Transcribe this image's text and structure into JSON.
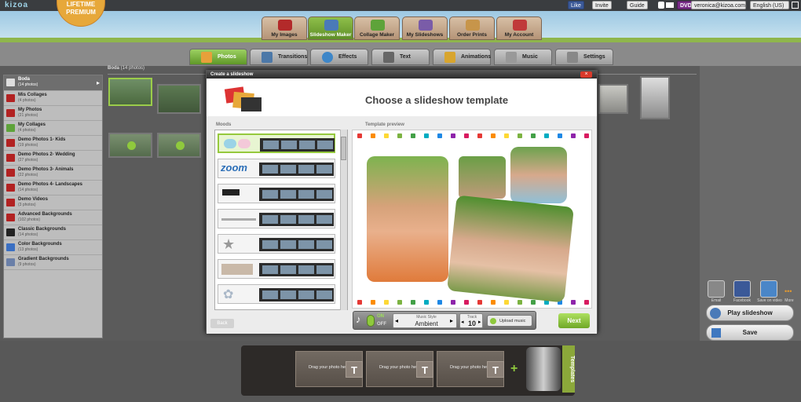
{
  "app": {
    "logo": "kizoa",
    "premium_line1": "LIFETIME",
    "premium_line2": "PREMIUM"
  },
  "topbar": {
    "like": "Like",
    "invite": "Invite",
    "guide": "Guide",
    "dvd": "DVD",
    "email": "veronica@kizoa.com",
    "language": "English (US)"
  },
  "main_tabs": [
    {
      "label": "My Images"
    },
    {
      "label": "Slideshow Maker"
    },
    {
      "label": "Collage Maker"
    },
    {
      "label": "My Slideshows"
    },
    {
      "label": "Order Prints"
    },
    {
      "label": "My Account"
    }
  ],
  "sub_tabs": [
    {
      "label": "Photos"
    },
    {
      "label": "Transitions"
    },
    {
      "label": "Effects"
    },
    {
      "label": "Text"
    },
    {
      "label": "Animations"
    },
    {
      "label": "Music"
    },
    {
      "label": "Settings"
    }
  ],
  "gallery": {
    "title": "Boda",
    "count": "(14 photos)"
  },
  "albums": [
    {
      "title": "Boda",
      "sub": "(14 photos)"
    },
    {
      "title": "Mis Collages",
      "sub": "(4 photos)"
    },
    {
      "title": "My Photos",
      "sub": "(21 photos)"
    },
    {
      "title": "My Collages",
      "sub": "(4 photos)"
    },
    {
      "title": "Demo Photos 1- Kids",
      "sub": "(19 photos)"
    },
    {
      "title": "Demo Photos 2- Wedding",
      "sub": "(27 photos)"
    },
    {
      "title": "Demo Photos 3- Animals",
      "sub": "(22 photos)"
    },
    {
      "title": "Demo Photos 4- Landscapes",
      "sub": "(14 photos)"
    },
    {
      "title": "Demo Videos",
      "sub": "(3 photos)"
    },
    {
      "title": "Advanced Backgrounds",
      "sub": "(102 photos)"
    },
    {
      "title": "Classic Backgrounds",
      "sub": "(14 photos)"
    },
    {
      "title": "Color Backgrounds",
      "sub": "(13 photos)"
    },
    {
      "title": "Gradient Backgrounds",
      "sub": "(9 photos)"
    }
  ],
  "modal": {
    "title": "Create a slideshow",
    "close": "×",
    "heading": "Choose a slideshow template",
    "moods_label": "Moods",
    "preview_label": "Template preview",
    "back": "Back",
    "next": "Next",
    "music_on": "ON",
    "music_off": "OFF",
    "music_style_label": "Music Style",
    "music_style": "Ambient",
    "track_label": "Track",
    "track": "10",
    "upload": "Upload music",
    "moods": [
      {
        "name": "mood-1",
        "selected": true
      },
      {
        "name": "mood-2"
      },
      {
        "name": "mood-3"
      },
      {
        "name": "mood-4"
      },
      {
        "name": "mood-5"
      },
      {
        "name": "mood-6"
      },
      {
        "name": "mood-7"
      }
    ],
    "dot_colors": [
      "#e53935",
      "#fb8c00",
      "#fdd835",
      "#7cb342",
      "#43a047",
      "#00acc1",
      "#1e88e5",
      "#8e24aa",
      "#d81b60",
      "#e53935",
      "#fb8c00",
      "#fdd835",
      "#7cb342",
      "#43a047",
      "#00acc1",
      "#1e88e5",
      "#8e24aa",
      "#d81b60"
    ]
  },
  "right": {
    "share": [
      "Email",
      "Facebook",
      "Save on video",
      "More"
    ],
    "play": "Play slideshow",
    "save": "Save"
  },
  "timeline": {
    "slots": [
      {
        "text": "Drag your photo here",
        "num": "1"
      },
      {
        "text": "Drag your photo here",
        "num": "2"
      },
      {
        "text": "Drag your photo here",
        "num": "3"
      }
    ],
    "templates": "Templates"
  }
}
